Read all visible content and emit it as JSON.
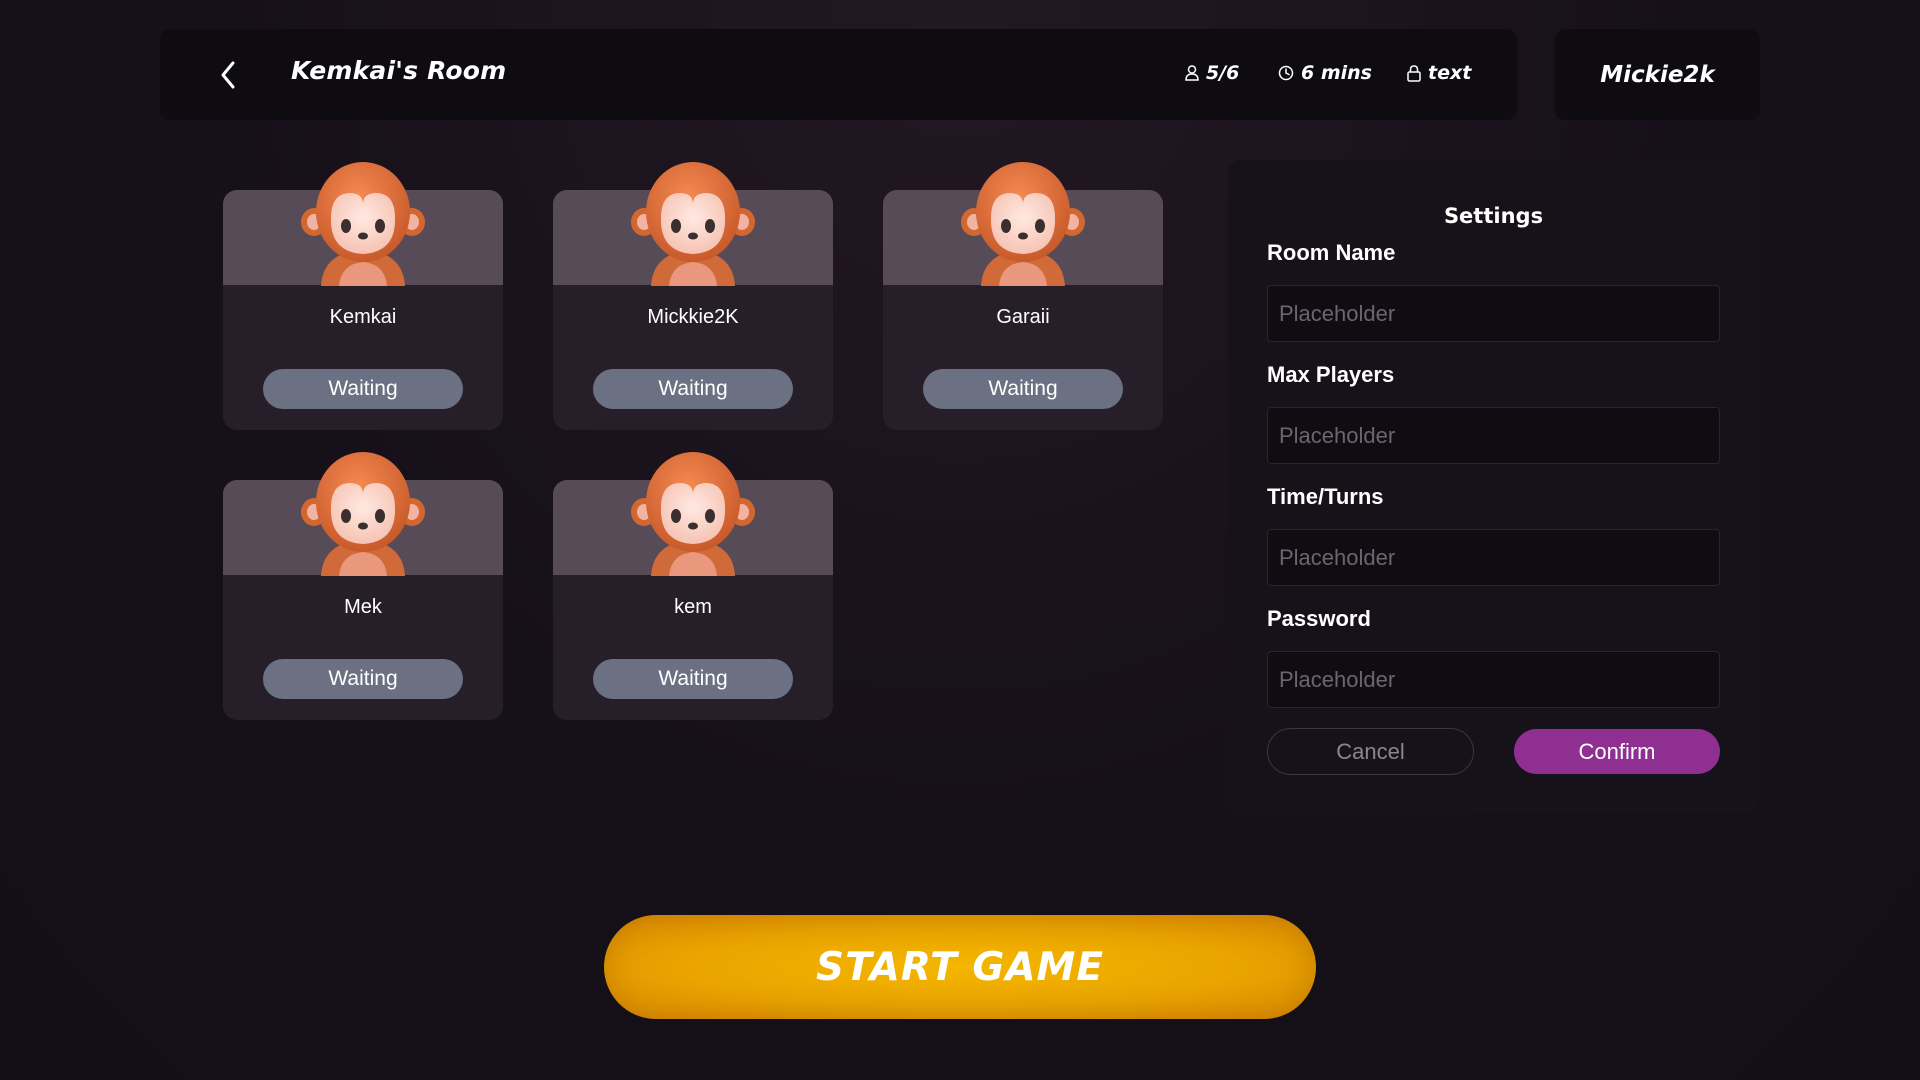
{
  "header": {
    "room_title": "Kemkai's Room",
    "players": "5/6",
    "time": "6 mins",
    "lock_text": "text",
    "username": "Mickie2k"
  },
  "players": [
    {
      "name": "Kemkai",
      "status": "Waiting"
    },
    {
      "name": "Mickkie2K",
      "status": "Waiting"
    },
    {
      "name": "Garaii",
      "status": "Waiting"
    },
    {
      "name": "Mek",
      "status": "Waiting"
    },
    {
      "name": "kem",
      "status": "Waiting"
    }
  ],
  "settings": {
    "title": "Settings",
    "fields": [
      {
        "label": "Room Name",
        "placeholder": "Placeholder",
        "value": ""
      },
      {
        "label": "Max Players",
        "placeholder": "Placeholder",
        "value": ""
      },
      {
        "label": "Time/Turns",
        "placeholder": "Placeholder",
        "value": ""
      },
      {
        "label": "Password",
        "placeholder": "Placeholder",
        "value": ""
      }
    ],
    "cancel_label": "Cancel",
    "confirm_label": "Confirm"
  },
  "start_label": "START GAME",
  "colors": {
    "accent_purple": "#8e2f91",
    "start_gold": "#f4b600",
    "status_pill": "#6b7182",
    "card_bg": "#261f2a",
    "card_top": "#574b58"
  },
  "icons": {
    "back": "chevron-left-icon",
    "players": "user-icon",
    "time": "clock-icon",
    "lock": "lock-icon",
    "avatar": "monkey-avatar-icon"
  }
}
